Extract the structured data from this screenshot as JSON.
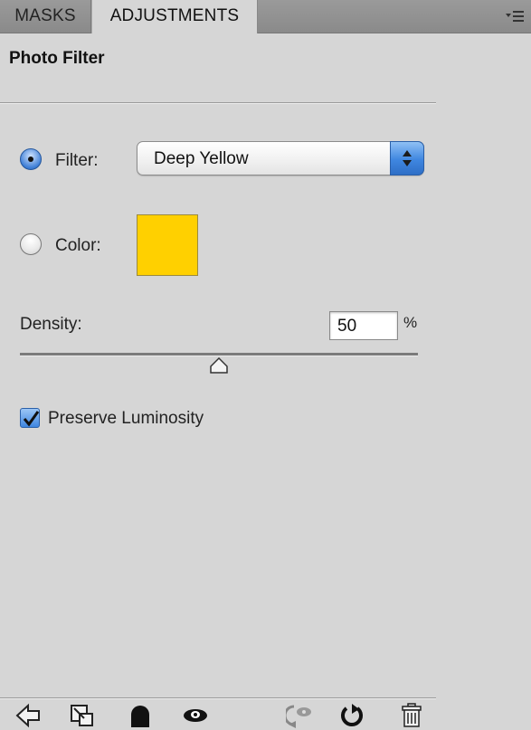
{
  "tabs": [
    {
      "label": "MASKS",
      "active": false
    },
    {
      "label": "ADJUSTMENTS",
      "active": true
    }
  ],
  "panel": {
    "title": "Photo Filter",
    "filter": {
      "label": "Filter:",
      "selected": true,
      "value": "Deep Yellow"
    },
    "color": {
      "label": "Color:",
      "selected": false,
      "swatch": "#ffd000"
    },
    "density": {
      "label": "Density:",
      "value": "50",
      "unit": "%",
      "slider_fraction": 0.5
    },
    "preserve_luminosity": {
      "label": "Preserve Luminosity",
      "checked": true
    }
  },
  "footer_icons": [
    "back-arrow-icon",
    "clip-to-layer-icon",
    "layer-visibility-mask-icon",
    "eye-icon",
    "view-previous-state-icon",
    "reset-icon",
    "trash-icon"
  ],
  "colors": {
    "panel_bg": "#d6d6d6",
    "tab_bar": "#8f8f8f",
    "accent_blue": "#3f86e0",
    "swatch_yellow": "#ffd000"
  }
}
